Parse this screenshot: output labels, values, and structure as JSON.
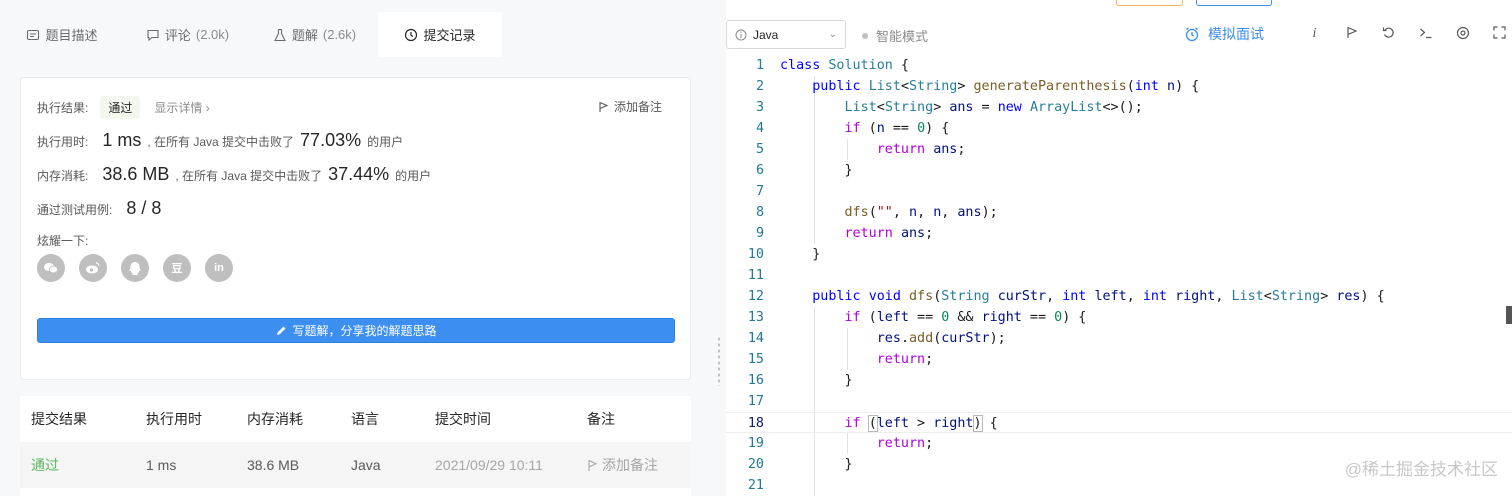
{
  "tabs": [
    {
      "label": "题目描述",
      "count": ""
    },
    {
      "label": "评论",
      "count": "(2.0k)"
    },
    {
      "label": "题解",
      "count": "(2.6k)"
    },
    {
      "label": "提交记录",
      "count": ""
    }
  ],
  "result": {
    "status_label": "执行结果:",
    "status_value": "通过",
    "detail_link": "显示详情 ›",
    "add_note": "添加备注",
    "time_label": "执行用时:",
    "time_value": "1 ms",
    "time_mid": ", 在所有 Java 提交中击败了",
    "time_pct": "77.03%",
    "time_suffix": "的用户",
    "mem_label": "内存消耗:",
    "mem_value": "38.6 MB",
    "mem_mid": ", 在所有 Java 提交中击败了",
    "mem_pct": "37.44%",
    "mem_suffix": "的用户",
    "tests_label": "通过测试用例:",
    "tests_value": "8 / 8",
    "share_label": "炫耀一下:",
    "share_icons": [
      "wechat-icon",
      "weibo-icon",
      "qq-icon",
      "douban-icon",
      "linkedin-icon"
    ],
    "write_button": "写题解，分享我的解题思路"
  },
  "table": {
    "headers": [
      "提交结果",
      "执行用时",
      "内存消耗",
      "语言",
      "提交时间",
      "备注"
    ],
    "rows": [
      [
        "通过",
        "1 ms",
        "38.6 MB",
        "Java",
        "2021/09/29 10:11",
        "添加备注"
      ]
    ]
  },
  "toolbar": {
    "language": "Java",
    "smart_mode": "智能模式",
    "mock_interview": "模拟面试"
  },
  "editor": {
    "current_line": 18,
    "lines": [
      "class Solution {",
      "    public List<String> generateParenthesis(int n) {",
      "        List<String> ans = new ArrayList<>();",
      "        if (n == 0) {",
      "            return ans;",
      "        }",
      "",
      "        dfs(\"\", n, n, ans);",
      "        return ans;",
      "    }",
      "",
      "    public void dfs(String curStr, int left, int right, List<String> res) {",
      "        if (left == 0 && right == 0) {",
      "            res.add(curStr);",
      "            return;",
      "        }",
      "",
      "        if (left > right) {",
      "            return;",
      "        }",
      ""
    ]
  },
  "watermark": "@稀土掘金技术社区",
  "colors": {
    "accent": "#3c8ef0",
    "success": "#5cb85c",
    "keyword": "#0000ff",
    "type": "#267f99"
  }
}
